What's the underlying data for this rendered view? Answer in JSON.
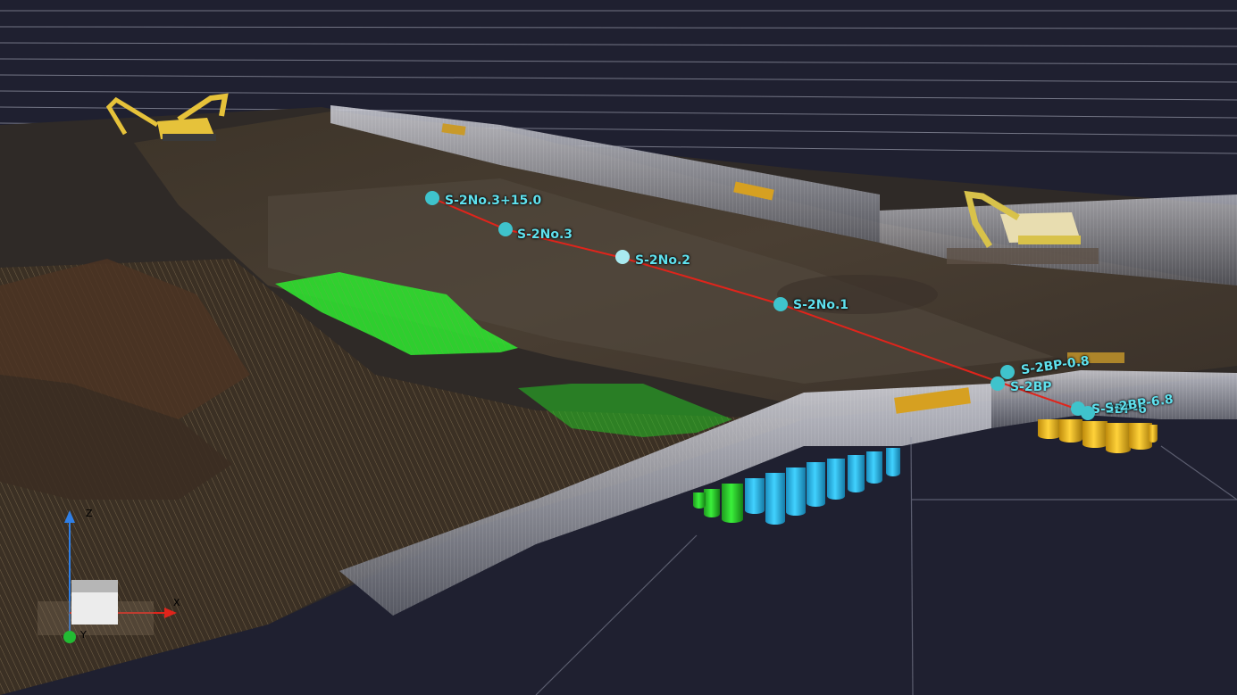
{
  "scene": {
    "background_color": "#1f2030",
    "grid_color": "#b9bccb",
    "alignment_line_color": "#e0241b"
  },
  "stations": [
    {
      "id": "s2-no3-15",
      "label": "S-2No.3+15.0"
    },
    {
      "id": "s2-no3",
      "label": "S-2No.3"
    },
    {
      "id": "s2-no2",
      "label": "S-2No.2"
    },
    {
      "id": "s2-no1",
      "label": "S-2No.1"
    },
    {
      "id": "s2-bp-08",
      "label": "S-2BP-0.8"
    },
    {
      "id": "s2-bp",
      "label": "S-2BP"
    },
    {
      "id": "s2-bp-6",
      "label": "S-2BP-6"
    },
    {
      "id": "s2-bp-68",
      "label": "S-2BP-6.8"
    }
  ],
  "piles": {
    "green_color": "#2fdc2f",
    "blue_color": "#33c5f0",
    "yellow_color": "#f3c21c"
  },
  "axes": {
    "x_label": "X",
    "y_label": "Y",
    "z_label": "Z",
    "x_color": "#e0241b",
    "y_color": "#22bb33",
    "z_color": "#2f7fe6"
  }
}
